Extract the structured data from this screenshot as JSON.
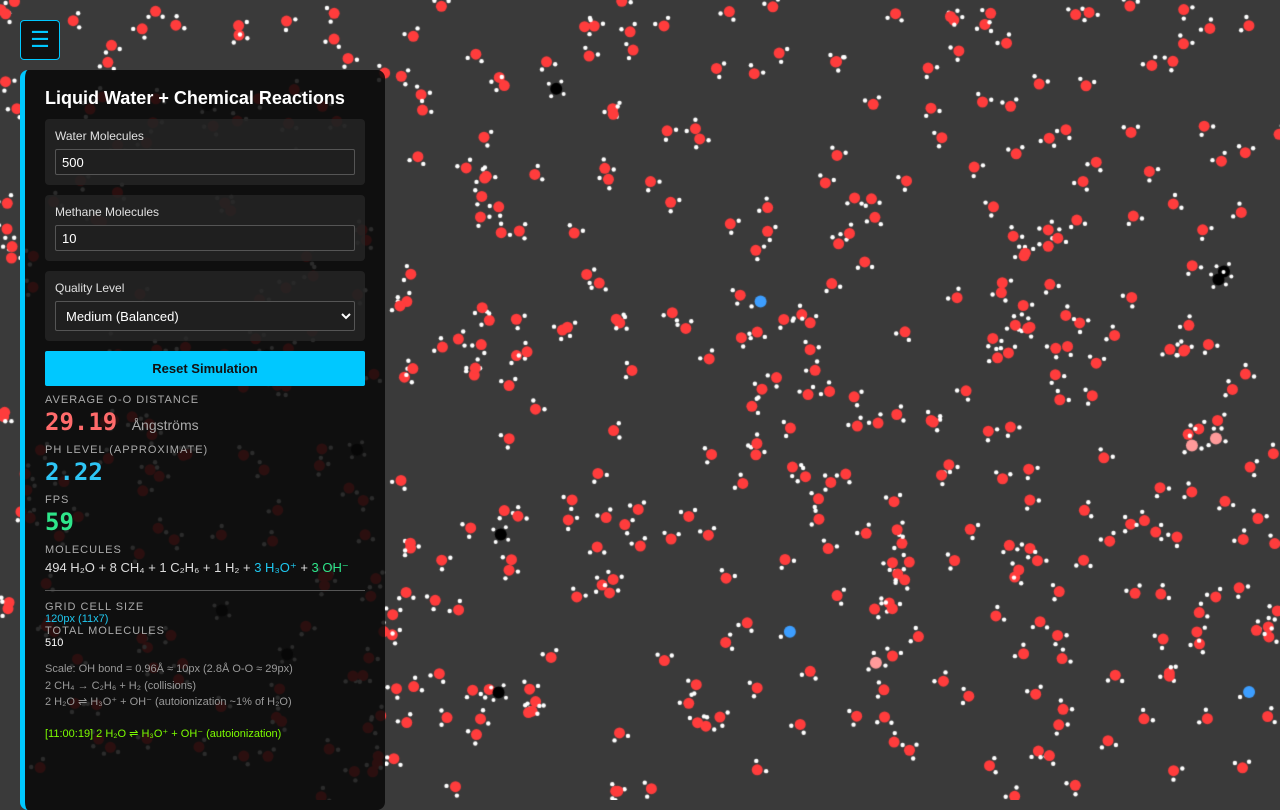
{
  "menu_icon": "hamburger-icon",
  "menu_glyph": "☰",
  "title": "Liquid Water + Chemical Reactions",
  "water": {
    "label": "Water Molecules",
    "value": "500"
  },
  "methane": {
    "label": "Methane Molecules",
    "value": "10"
  },
  "quality": {
    "label": "Quality Level",
    "selected": "Medium (Balanced)"
  },
  "reset_label": "Reset Simulation",
  "avg_oo": {
    "label": "AVERAGE O-O DISTANCE",
    "value": "29.19",
    "unit": "Ångströms"
  },
  "ph": {
    "label": "PH LEVEL (APPROXIMATE)",
    "value": "2.22"
  },
  "fps": {
    "label": "FPS",
    "value": "59"
  },
  "molecules": {
    "label": "MOLECULES",
    "plain": "494 H₂O + 8 CH₄ + 1 C₂H₆ + 1 H₂ + ",
    "h3o": "3 H₃O⁺",
    "plus": " + ",
    "oh": "3 OH⁻"
  },
  "grid_cell": {
    "label": "GRID CELL SIZE",
    "value": "120px (11x7)"
  },
  "total": {
    "label": "TOTAL MOLECULES",
    "value": "510"
  },
  "notes": {
    "scale": "Scale: OH bond = 0.96Å ≈ 10px (2.8Å O-O ≈ 29px)",
    "reaction1": "2 CH₄ → C₂H₆ + H₂ (collisions)",
    "reaction2": "2 H₂O ⇌ H₃O⁺ + OH⁻ (autoionization ~1% of H₂O)"
  },
  "log_line": "[11:00:19] 2 H₂O ⇌ H₃O⁺ + OH⁻ (autoionization)",
  "colors": {
    "accent": "#00c8ff",
    "background": "#3a3a3a",
    "oxygen": "#ff3c3c",
    "hydrogen": "#ffffff",
    "carbon": "#000000",
    "hydronium": "#ff9a9a",
    "hydroxide": "#3d9eff",
    "oo_distance": "#ff6b6b",
    "ph": "#2ec5f5",
    "fps": "#2ee68a",
    "h3o_text": "#1fc8f0",
    "oh_text": "#2ee68a",
    "grid_value": "#1fc8f0",
    "log": "#7cfc00"
  }
}
